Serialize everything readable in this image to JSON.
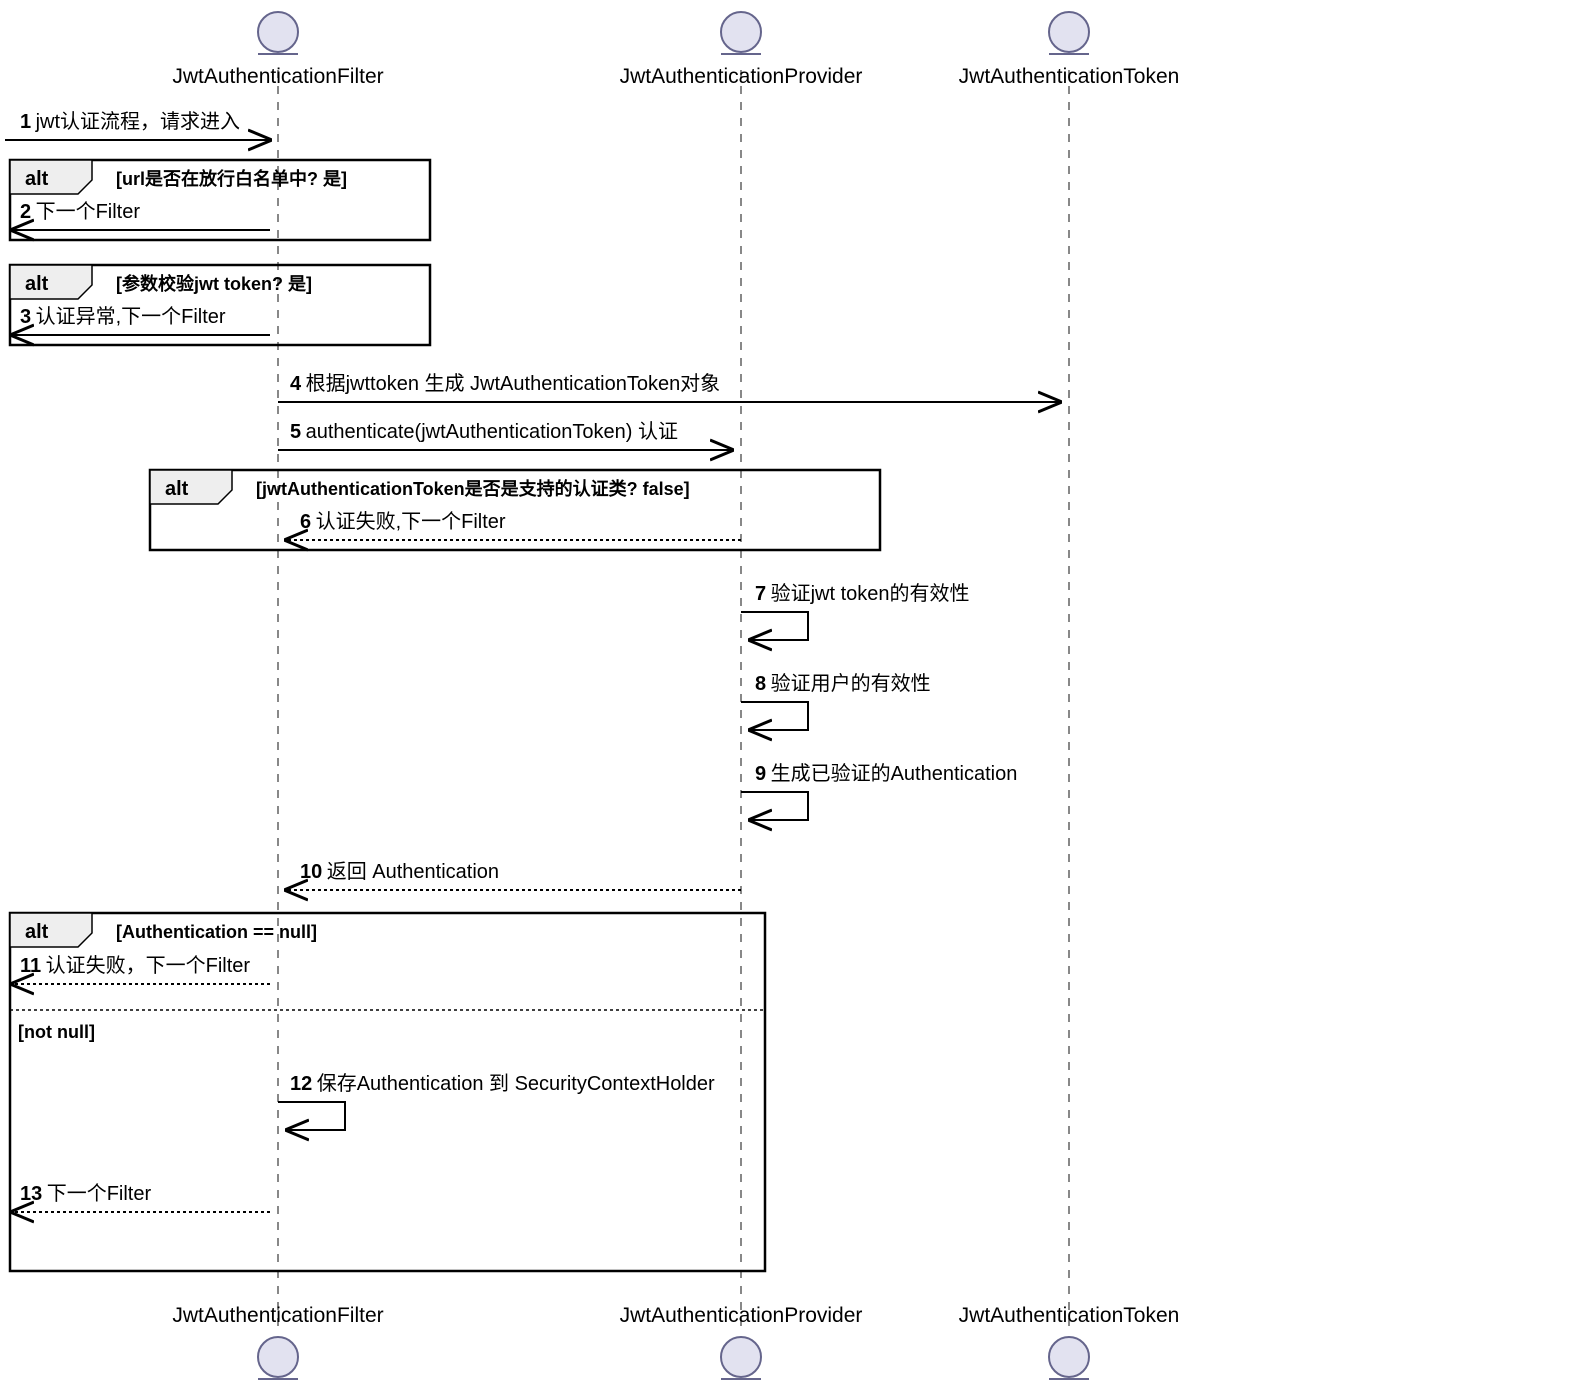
{
  "participants": {
    "p1": "JwtAuthenticationFilter",
    "p2": "JwtAuthenticationProvider",
    "p3": "JwtAuthenticationToken"
  },
  "messages": {
    "m1": {
      "num": "1",
      "text": "jwt认证流程，请求进入"
    },
    "m2": {
      "num": "2",
      "text": "下一个Filter"
    },
    "m3": {
      "num": "3",
      "text": "认证异常,下一个Filter"
    },
    "m4": {
      "num": "4",
      "text": "根据jwttoken 生成 JwtAuthenticationToken对象"
    },
    "m5": {
      "num": "5",
      "text": "authenticate(jwtAuthenticationToken) 认证"
    },
    "m6": {
      "num": "6",
      "text": "认证失败,下一个Filter"
    },
    "m7": {
      "num": "7",
      "text": "验证jwt token的有效性"
    },
    "m8": {
      "num": "8",
      "text": "验证用户的有效性"
    },
    "m9": {
      "num": "9",
      "text": "生成已验证的Authentication"
    },
    "m10": {
      "num": "10",
      "text": "返回 Authentication"
    },
    "m11": {
      "num": "11",
      "text": "认证失败，下一个Filter"
    },
    "m12": {
      "num": "12",
      "text": "保存Authentication 到 SecurityContextHolder"
    },
    "m13": {
      "num": "13",
      "text": "下一个Filter"
    }
  },
  "fragments": {
    "alt1": {
      "label": "alt",
      "condition": "[url是否在放行白名单中? 是]"
    },
    "alt2": {
      "label": "alt",
      "condition": "[参数校验jwt token? 是]"
    },
    "alt3": {
      "label": "alt",
      "condition": "[jwtAuthenticationToken是否是支持的认证类? false]"
    },
    "alt4": {
      "label": "alt",
      "condition1": "[Authentication == null]",
      "condition2": "[not null]"
    }
  }
}
